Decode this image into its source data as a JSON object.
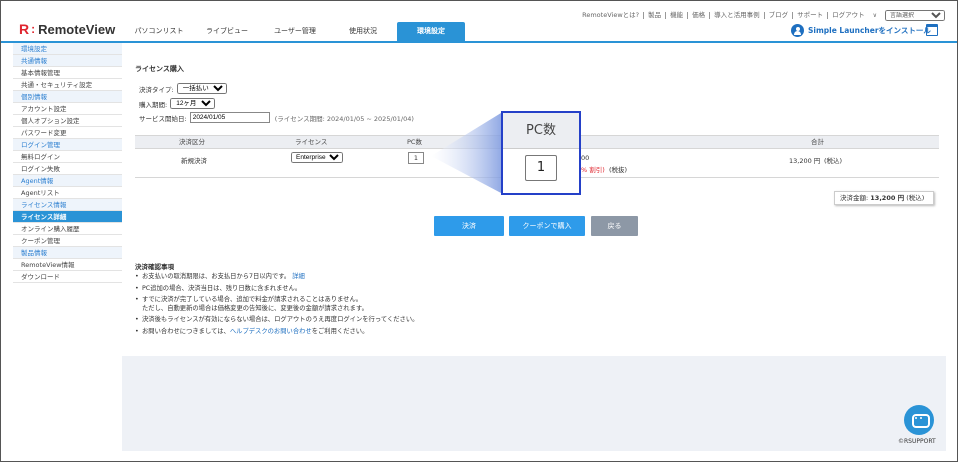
{
  "toplinks": {
    "items": [
      "RemoteViewとは?",
      "製品",
      "機能",
      "価格",
      "導入と活用事例",
      "ブログ",
      "サポート",
      "ログアウト"
    ],
    "chevron": "∨",
    "language_select": "言語選択"
  },
  "header": {
    "logo_r": "R",
    "logo_colon": ":",
    "logo_text": "RemoteView",
    "tabs": [
      {
        "label": "パソコンリスト",
        "active": false
      },
      {
        "label": "ライブビュー",
        "active": false
      },
      {
        "label": "ユーザー管理",
        "active": false
      },
      {
        "label": "使用状況",
        "active": false
      },
      {
        "label": "環境設定",
        "active": true
      }
    ],
    "launcher_label": "Simple Launcherをインストール",
    "accent": "#2a93d6"
  },
  "sidebar": {
    "items": [
      {
        "label": "環境設定",
        "kind": "group"
      },
      {
        "label": "共通情報",
        "kind": "group"
      },
      {
        "label": "基本情報管理",
        "kind": "item"
      },
      {
        "label": "共通・セキュリティ設定",
        "kind": "item"
      },
      {
        "label": "個別情報",
        "kind": "group"
      },
      {
        "label": "アカウント設定",
        "kind": "item"
      },
      {
        "label": "個人オプション設定",
        "kind": "item"
      },
      {
        "label": "パスワード変更",
        "kind": "item"
      },
      {
        "label": "ログイン管理",
        "kind": "group"
      },
      {
        "label": "無料ログイン",
        "kind": "item"
      },
      {
        "label": "ログイン失敗",
        "kind": "item"
      },
      {
        "label": "Agent情報",
        "kind": "group"
      },
      {
        "label": "Agentリスト",
        "kind": "item"
      },
      {
        "label": "ライセンス情報",
        "kind": "group"
      },
      {
        "label": "ライセンス詳細",
        "kind": "active"
      },
      {
        "label": "オンライン購入履歴",
        "kind": "item"
      },
      {
        "label": "クーポン管理",
        "kind": "item"
      },
      {
        "label": "製品情報",
        "kind": "group"
      },
      {
        "label": "RemoteView情報",
        "kind": "item"
      },
      {
        "label": "ダウンロード",
        "kind": "item"
      }
    ]
  },
  "page": {
    "title": "ライセンス購入",
    "payment_type_label": "決済タイプ:",
    "payment_type_value": "一括払い",
    "period_label": "購入期間:",
    "period_value": "12ヶ月",
    "start_label": "サービス開始日:",
    "start_value": "2024/01/05",
    "license_period": "(ライセンス期間: 2024/01/05 ~ 2025/01/04)"
  },
  "table": {
    "headers": [
      "決済区分",
      "ライセンス",
      "PC数",
      "合計"
    ],
    "row": {
      "type": "新規決済",
      "license": "Enterprise",
      "pc_count": "1",
      "price_fragment": "00",
      "discount_fragment": "% 割引)",
      "tax_exempt": "(税抜)",
      "total": "13,200 円",
      "total_tax": "(税込)"
    }
  },
  "summary": {
    "label": "決済金額:",
    "amount": "13,200 円",
    "tax": "(税込)"
  },
  "buttons": {
    "pay": "決済",
    "coupon": "クーポンで購入",
    "back": "戻る"
  },
  "notes": {
    "title": "決済確認事項",
    "items": [
      {
        "text": "お支払いの取消期限は、お支払日から7日以内です。",
        "link": "詳細",
        "tail": ""
      },
      {
        "text": "PC追加の場合、決済当日は、残り日数に含まれません。",
        "link": "",
        "tail": ""
      },
      {
        "text": "すでに決済が完了している場合、追加で料金が請求されることはありません。",
        "line2": "ただし、自動更新の場合は価格変更の告知後に、変更後の金額が請求されます。",
        "link": "",
        "tail": ""
      },
      {
        "text": "決済後もライセンスが有効にならない場合は、ログアウトのうえ再度ログインを行ってください。",
        "link": "",
        "tail": ""
      },
      {
        "text": "お問い合わせにつきましては、",
        "link": "ヘルプデスクのお問い合わせ",
        "tail": "をご利用ください。"
      }
    ]
  },
  "zoom": {
    "header": "PC数",
    "value": "1"
  },
  "footer": {
    "copyright": "©RSUPPORT"
  }
}
